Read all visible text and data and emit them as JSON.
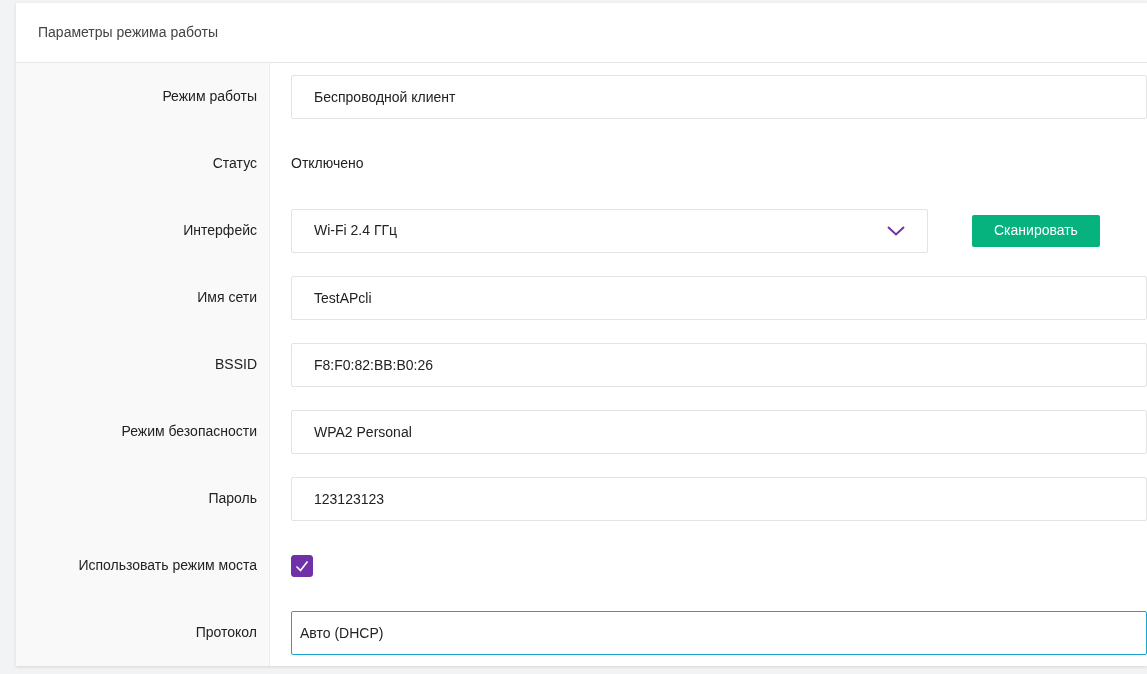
{
  "panel": {
    "title": "Параметры режима работы"
  },
  "rows": [
    {
      "label": "Режим работы",
      "kind": "input",
      "value": "Беспроводной клиент",
      "focused": false
    },
    {
      "label": "Статус",
      "kind": "text",
      "value": "Отключено"
    },
    {
      "label": "Интерфейс",
      "kind": "select",
      "value": "Wi-Fi 2.4 ГГц",
      "button": "Сканировать"
    },
    {
      "label": "Имя сети",
      "kind": "input",
      "value": "TestAPcli",
      "focused": false
    },
    {
      "label": "BSSID",
      "kind": "input",
      "value": "F8:F0:82:BB:B0:26",
      "focused": false
    },
    {
      "label": "Режим безопасности",
      "kind": "input",
      "value": "WPA2 Personal",
      "focused": false
    },
    {
      "label": "Пароль",
      "kind": "input",
      "value": "123123123",
      "focused": false
    },
    {
      "label": "Использовать режим моста",
      "kind": "checkbox",
      "checked": true
    },
    {
      "label": "Протокол",
      "kind": "input",
      "value": "Авто (DHCP)",
      "focused": true
    }
  ]
}
